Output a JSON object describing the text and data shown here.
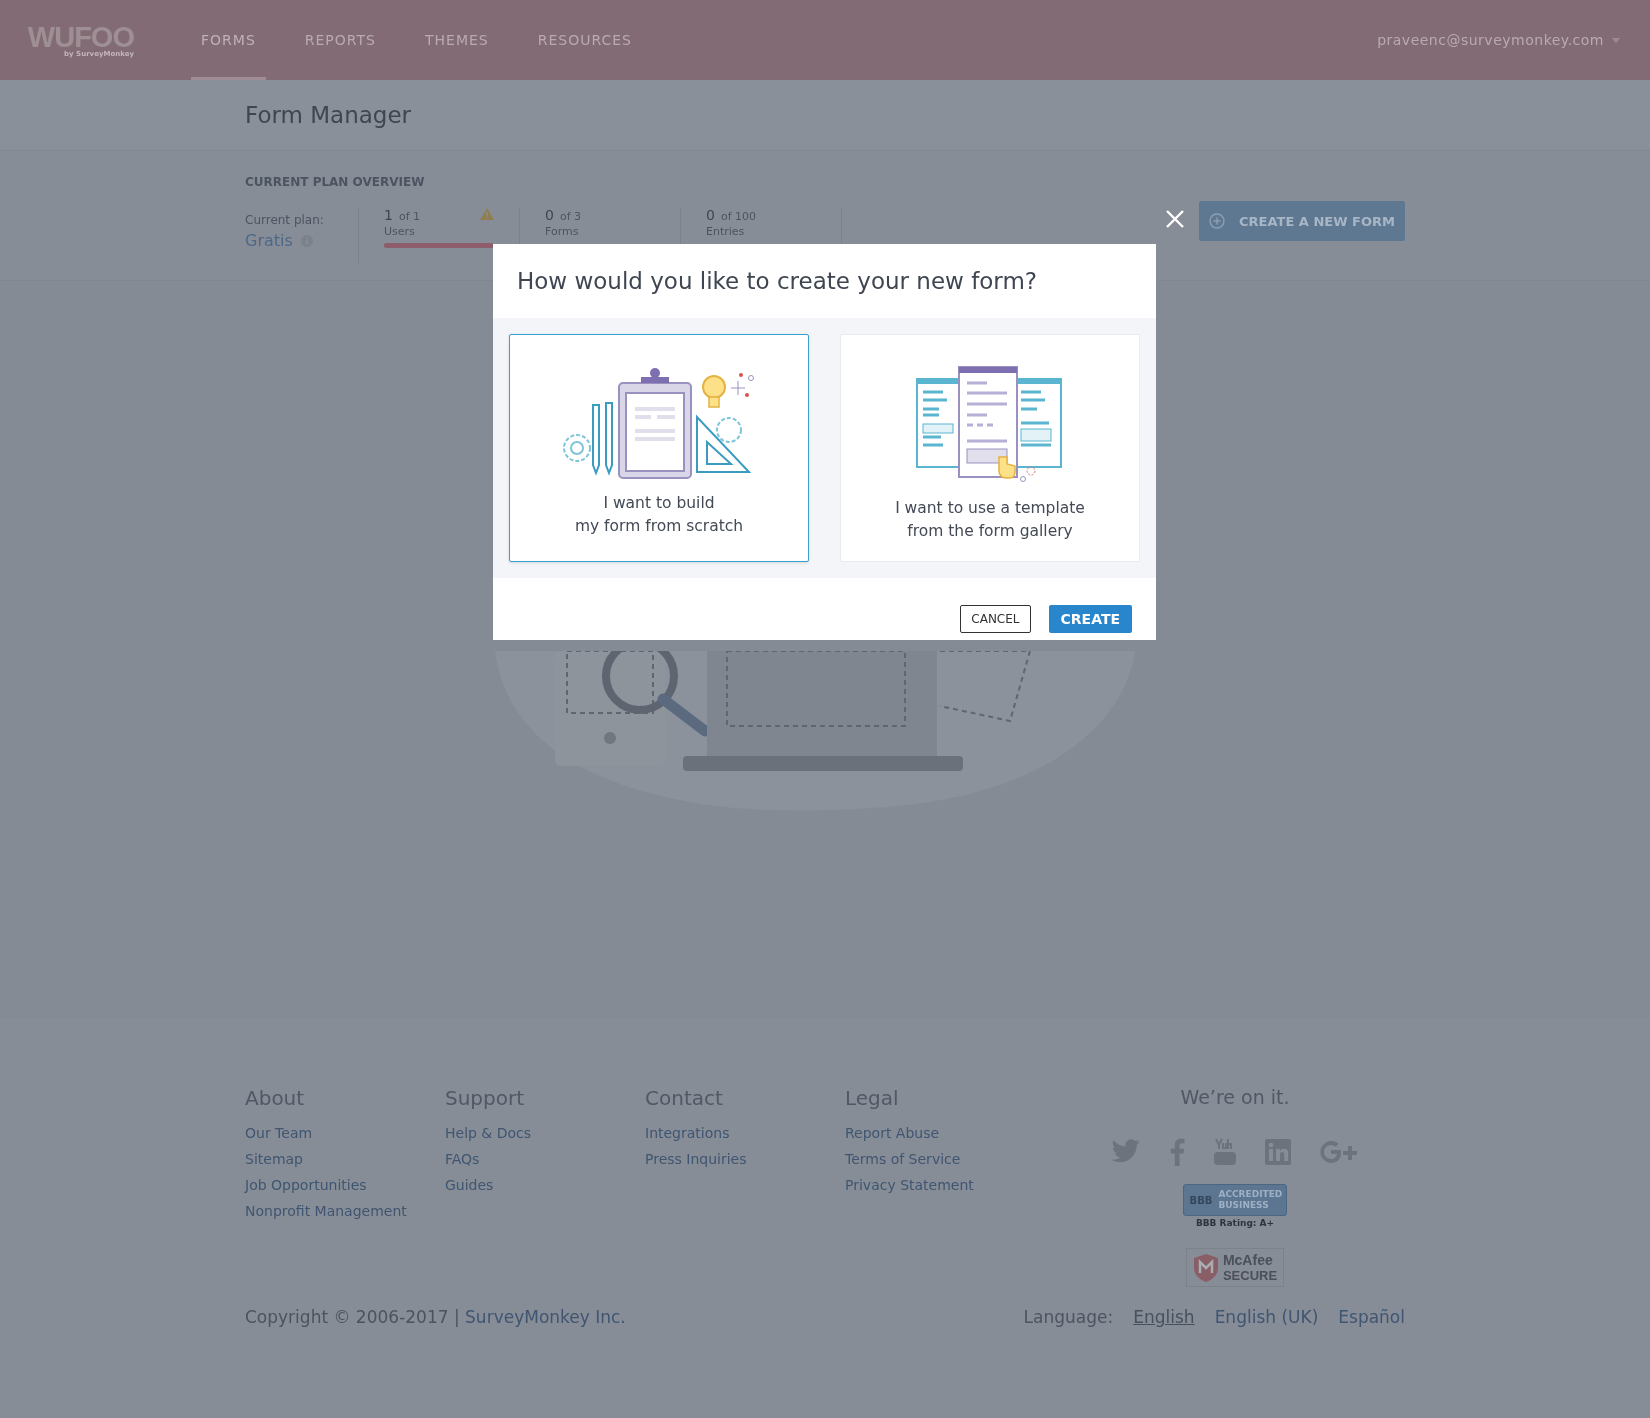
{
  "header": {
    "logo": "WUFOO",
    "logo_sub": "by SurveyMonkey",
    "nav": [
      {
        "label": "FORMS",
        "selected": true
      },
      {
        "label": "REPORTS",
        "selected": false
      },
      {
        "label": "THEMES",
        "selected": false
      },
      {
        "label": "RESOURCES",
        "selected": false
      }
    ],
    "user_menu": "praveenc@surveymonkey.com"
  },
  "page_title": "Form Manager",
  "plan_overview": {
    "heading": "CURRENT PLAN OVERVIEW",
    "plan_label": "Current plan:",
    "plan_name": "Gratis",
    "stats": [
      {
        "value": "1",
        "limit": "of 1",
        "label": "Users",
        "warning": true,
        "level": 1
      },
      {
        "value": "0",
        "limit": "of 3",
        "label": "Forms",
        "warning": false
      },
      {
        "value": "0",
        "limit": "of 100",
        "label": "Entries",
        "warning": false
      }
    ],
    "create_button": "CREATE A NEW FORM"
  },
  "modal": {
    "title": "How would you like to create your new form?",
    "options": [
      {
        "kind": "scratch",
        "lines": [
          "I want to build",
          "my form from scratch"
        ],
        "selected": true
      },
      {
        "kind": "template",
        "lines": [
          "I want to use a template",
          "from the form gallery"
        ],
        "selected": false
      }
    ],
    "cancel": "CANCEL",
    "create": "CREATE"
  },
  "footer": {
    "columns": [
      {
        "heading": "About",
        "links": [
          "Our Team",
          "Sitemap",
          "Job Opportunities",
          "Nonprofit Management"
        ]
      },
      {
        "heading": "Support",
        "links": [
          "Help & Docs",
          "FAQs",
          "Guides"
        ]
      },
      {
        "heading": "Contact",
        "links": [
          "Integrations",
          "Press Inquiries"
        ]
      },
      {
        "heading": "Legal",
        "links": [
          "Report Abuse",
          "Terms of Service",
          "Privacy Statement"
        ]
      }
    ],
    "social_heading": "We’re on it.",
    "bbb": {
      "mark": "BBB",
      "text": "ACCREDITED BUSINESS",
      "rating": "BBB Rating: A+"
    },
    "mcafee": {
      "name": "McAfee",
      "text": "SECURE"
    },
    "copyright": "Copyright © 2006-2017 | ",
    "company": "SurveyMonkey Inc.",
    "language_label": "Language:",
    "languages": [
      {
        "label": "English",
        "selected": true
      },
      {
        "label": "English (UK)",
        "selected": false
      },
      {
        "label": "Español",
        "selected": false
      }
    ]
  }
}
